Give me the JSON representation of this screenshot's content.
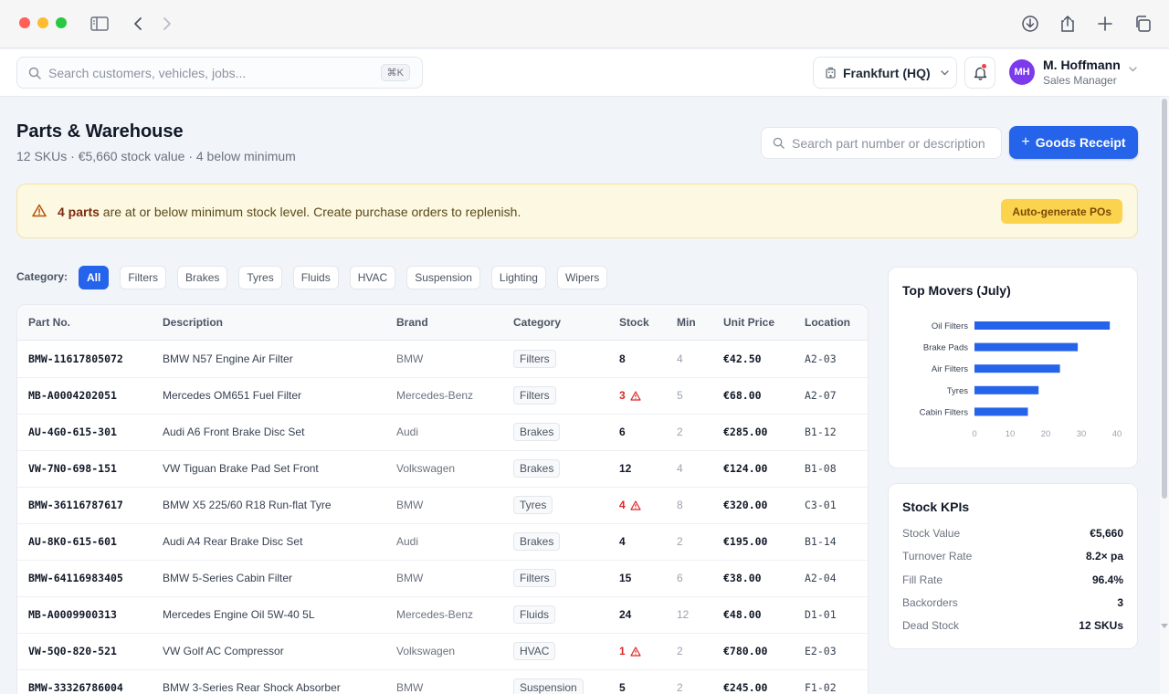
{
  "header": {
    "search_placeholder": "Search customers, vehicles, jobs...",
    "search_shortcut": "⌘K",
    "location": "Frankfurt (HQ)",
    "user": {
      "initials": "MH",
      "name": "M. Hoffmann",
      "role": "Sales Manager",
      "avatar_color": "#7c3aed"
    }
  },
  "page": {
    "title": "Parts & Warehouse",
    "subtitle": "12 SKUs · €5,660 stock value · 4 below minimum",
    "part_search_placeholder": "Search part number or description",
    "primary_button": "Goods Receipt"
  },
  "alert": {
    "strong": "4 parts",
    "text": " are at or below minimum stock level. Create purchase orders to replenish.",
    "button": "Auto-generate POs"
  },
  "filters": {
    "label": "Category:",
    "chips": [
      "All",
      "Filters",
      "Brakes",
      "Tyres",
      "Fluids",
      "HVAC",
      "Suspension",
      "Lighting",
      "Wipers"
    ],
    "active": "All"
  },
  "table": {
    "columns": [
      "Part No.",
      "Description",
      "Brand",
      "Category",
      "Stock",
      "Min",
      "Unit Price",
      "Location"
    ],
    "rows": [
      {
        "part": "BMW-11617805072",
        "desc": "BMW N57 Engine Air Filter",
        "brand": "BMW",
        "category": "Filters",
        "stock": "8",
        "min": "4",
        "price": "€42.50",
        "location": "A2-03",
        "low": false
      },
      {
        "part": "MB-A0004202051",
        "desc": "Mercedes OM651 Fuel Filter",
        "brand": "Mercedes-Benz",
        "category": "Filters",
        "stock": "3",
        "min": "5",
        "price": "€68.00",
        "location": "A2-07",
        "low": true
      },
      {
        "part": "AU-4G0-615-301",
        "desc": "Audi A6 Front Brake Disc Set",
        "brand": "Audi",
        "category": "Brakes",
        "stock": "6",
        "min": "2",
        "price": "€285.00",
        "location": "B1-12",
        "low": false
      },
      {
        "part": "VW-7N0-698-151",
        "desc": "VW Tiguan Brake Pad Set Front",
        "brand": "Volkswagen",
        "category": "Brakes",
        "stock": "12",
        "min": "4",
        "price": "€124.00",
        "location": "B1-08",
        "low": false
      },
      {
        "part": "BMW-36116787617",
        "desc": "BMW X5 225/60 R18 Run-flat Tyre",
        "brand": "BMW",
        "category": "Tyres",
        "stock": "4",
        "min": "8",
        "price": "€320.00",
        "location": "C3-01",
        "low": true
      },
      {
        "part": "AU-8K0-615-601",
        "desc": "Audi A4 Rear Brake Disc Set",
        "brand": "Audi",
        "category": "Brakes",
        "stock": "4",
        "min": "2",
        "price": "€195.00",
        "location": "B1-14",
        "low": false
      },
      {
        "part": "BMW-64116983405",
        "desc": "BMW 5-Series Cabin Filter",
        "brand": "BMW",
        "category": "Filters",
        "stock": "15",
        "min": "6",
        "price": "€38.00",
        "location": "A2-04",
        "low": false
      },
      {
        "part": "MB-A0009900313",
        "desc": "Mercedes Engine Oil 5W-40 5L",
        "brand": "Mercedes-Benz",
        "category": "Fluids",
        "stock": "24",
        "min": "12",
        "price": "€48.00",
        "location": "D1-01",
        "low": false
      },
      {
        "part": "VW-5Q0-820-521",
        "desc": "VW Golf AC Compressor",
        "brand": "Volkswagen",
        "category": "HVAC",
        "stock": "1",
        "min": "2",
        "price": "€780.00",
        "location": "E2-03",
        "low": true
      },
      {
        "part": "BMW-33326786004",
        "desc": "BMW 3-Series Rear Shock Absorber",
        "brand": "BMW",
        "category": "Suspension",
        "stock": "5",
        "min": "2",
        "price": "€245.00",
        "location": "F1-02",
        "low": false
      }
    ]
  },
  "movers": {
    "title": "Top Movers (July)"
  },
  "chart_data": {
    "type": "bar",
    "orientation": "horizontal",
    "title": "Top Movers (July)",
    "categories": [
      "Oil Filters",
      "Brake Pads",
      "Air Filters",
      "Tyres",
      "Cabin Filters"
    ],
    "values": [
      38,
      29,
      24,
      18,
      15
    ],
    "xlim": [
      0,
      40
    ],
    "xticks": [
      "0",
      "10",
      "20",
      "30",
      "40"
    ],
    "bar_color": "#2563eb",
    "grid": false
  },
  "kpis": {
    "title": "Stock KPIs",
    "items": [
      {
        "label": "Stock Value",
        "value": "€5,660"
      },
      {
        "label": "Turnover Rate",
        "value": "8.2× pa"
      },
      {
        "label": "Fill Rate",
        "value": "96.4%"
      },
      {
        "label": "Backorders",
        "value": "3"
      },
      {
        "label": "Dead Stock",
        "value": "12 SKUs"
      }
    ]
  },
  "colors": {
    "accent": "#2563eb",
    "warning": "#dc2626",
    "alert_bg": "#fdf8e1"
  }
}
